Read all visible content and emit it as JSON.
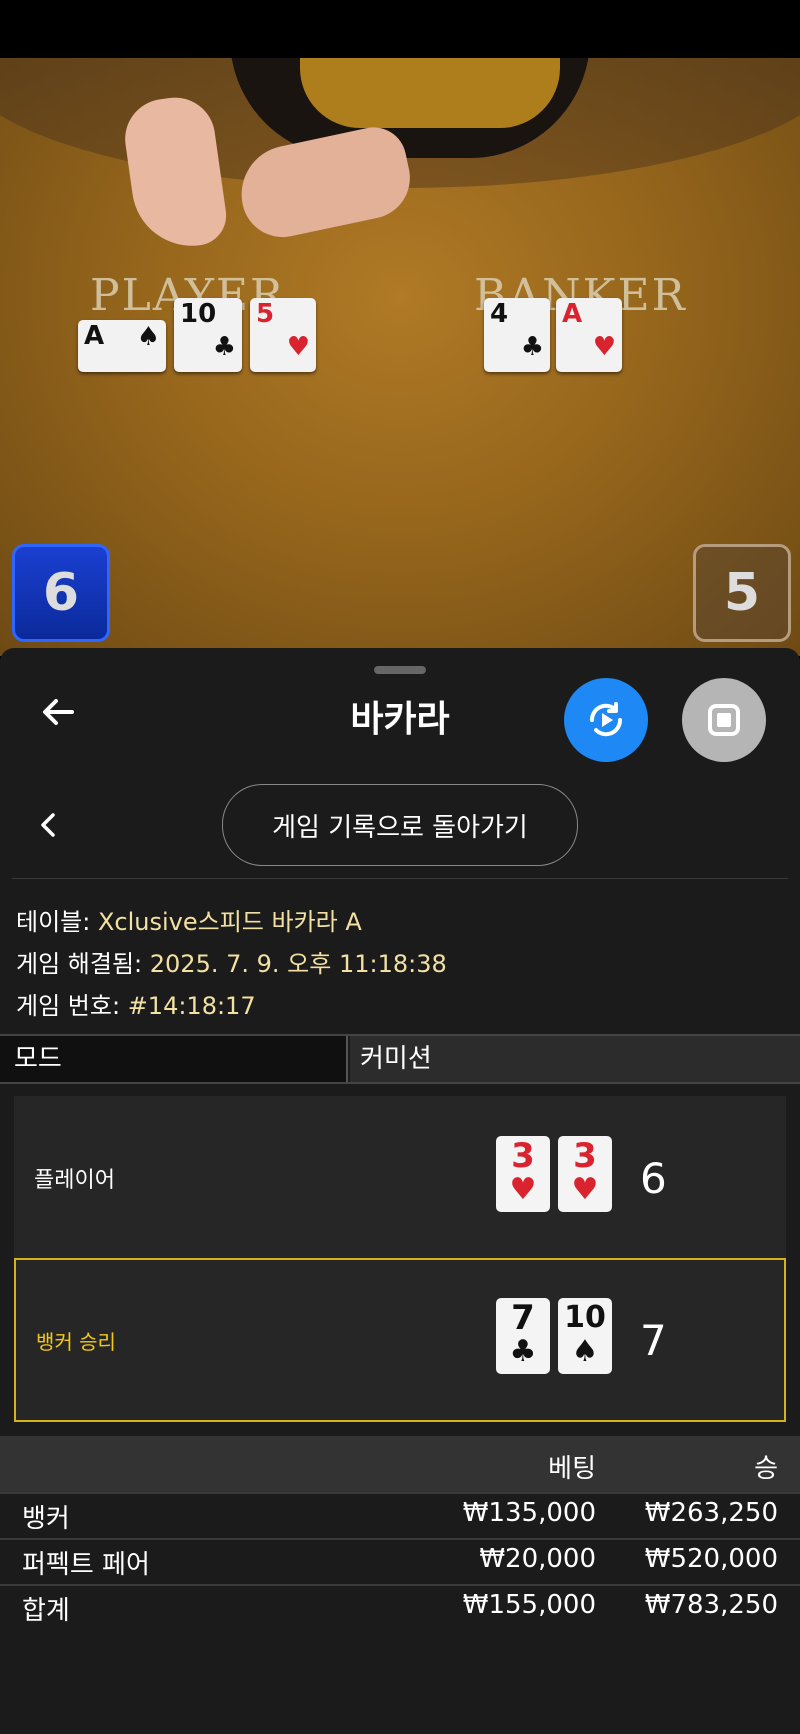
{
  "video": {
    "player_label": "PLAYER",
    "banker_label": "BANKER",
    "player_cards": [
      {
        "rank": "A",
        "suit": "♠",
        "color": "#111111"
      },
      {
        "rank": "10",
        "suit": "♣",
        "color": "#111111"
      },
      {
        "rank": "5",
        "suit": "♥",
        "color": "#d9232e"
      }
    ],
    "banker_cards": [
      {
        "rank": "4",
        "suit": "♣",
        "color": "#111111"
      },
      {
        "rank": "A",
        "suit": "♥",
        "color": "#d9232e"
      }
    ],
    "player_score": "6",
    "banker_score": "5"
  },
  "header": {
    "title": "바카라",
    "back_icon": "arrow-left-icon",
    "replay_icon": "replay-icon",
    "stop_icon": "stop-icon",
    "replay_color": "#1e88f5"
  },
  "nav": {
    "history_button": "게임 기록으로 돌아가기"
  },
  "info": {
    "table_label": "테이블:",
    "table_value": "Xclusive스피드 바카라 A",
    "resolved_label": "게임 해결됨:",
    "resolved_value": "2025. 7. 9. 오후 11:18:38",
    "number_label": "게임 번호:",
    "number_value": "#14:18:17"
  },
  "mode": {
    "col1": "모드",
    "col2": "커미션"
  },
  "hands": {
    "player": {
      "label": "플레이어",
      "cards": [
        {
          "rank": "3",
          "suit": "♥"
        },
        {
          "rank": "3",
          "suit": "♥"
        }
      ],
      "score": "6"
    },
    "banker": {
      "label": "뱅커 승리",
      "cards": [
        {
          "rank": "7",
          "suit": "♣"
        },
        {
          "rank": "10",
          "suit": "♠"
        }
      ],
      "score": "7",
      "highlight_color": "#d5b21c"
    }
  },
  "bets": {
    "header_bet": "베팅",
    "header_win": "승",
    "rows": [
      {
        "name": "뱅커",
        "bet": "₩135,000",
        "win": "₩263,250"
      },
      {
        "name": "퍼펙트 페어",
        "bet": "₩20,000",
        "win": "₩520,000"
      },
      {
        "name": "합계",
        "bet": "₩155,000",
        "win": "₩783,250"
      }
    ]
  }
}
